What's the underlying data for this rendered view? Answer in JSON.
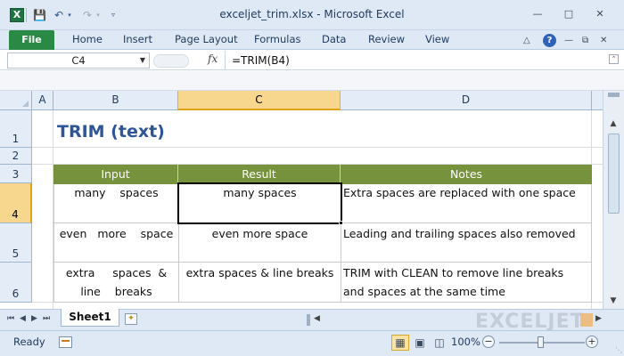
{
  "window": {
    "title": "exceljet_trim.xlsx - Microsoft Excel",
    "app_icon": "X",
    "quick_access": [
      "save-icon",
      "undo-icon",
      "redo-icon",
      "customize-icon"
    ],
    "controls": [
      "minimize-icon",
      "restore-icon",
      "close-icon"
    ]
  },
  "ribbon": {
    "file_tab": "File",
    "tabs": [
      "Home",
      "Insert",
      "Page Layout",
      "Formulas",
      "Data",
      "Review",
      "View"
    ],
    "help": "?"
  },
  "formula_bar": {
    "name_box": "C4",
    "fx": "fx",
    "formula": "=TRIM(B4)"
  },
  "grid": {
    "columns": [
      "A",
      "B",
      "C",
      "D"
    ],
    "selected_column": "C",
    "rows": [
      "1",
      "2",
      "3",
      "4",
      "5",
      "6"
    ],
    "selected_row": "4",
    "active_cell": "C4"
  },
  "sheet": {
    "title": "TRIM (text)",
    "table": {
      "headers": [
        "Input",
        "Result",
        "Notes"
      ],
      "rows": [
        {
          "input": "many    spaces",
          "result": "many spaces",
          "notes": "Extra spaces are replaced with one space"
        },
        {
          "input": "even   more    space",
          "result": "even more space",
          "notes": "Leading and trailing spaces also removed"
        },
        {
          "input_line1": "extra     spaces  &",
          "input_line2": "line    breaks",
          "result": "extra spaces & line breaks",
          "notes_line1": "TRIM with CLEAN to remove line breaks",
          "notes_line2": "and spaces at the same time"
        }
      ]
    }
  },
  "sheet_tabs": {
    "tabs": [
      "Sheet1"
    ],
    "active": "Sheet1"
  },
  "watermark": "EXCELJET",
  "status": {
    "text": "Ready",
    "zoom": "100%",
    "zoom_level": 1.0
  },
  "colors": {
    "table_header": "#76923c",
    "title": "#2e5597",
    "file_tab": "#2a8a45",
    "selected_header": "#f7d78e"
  }
}
